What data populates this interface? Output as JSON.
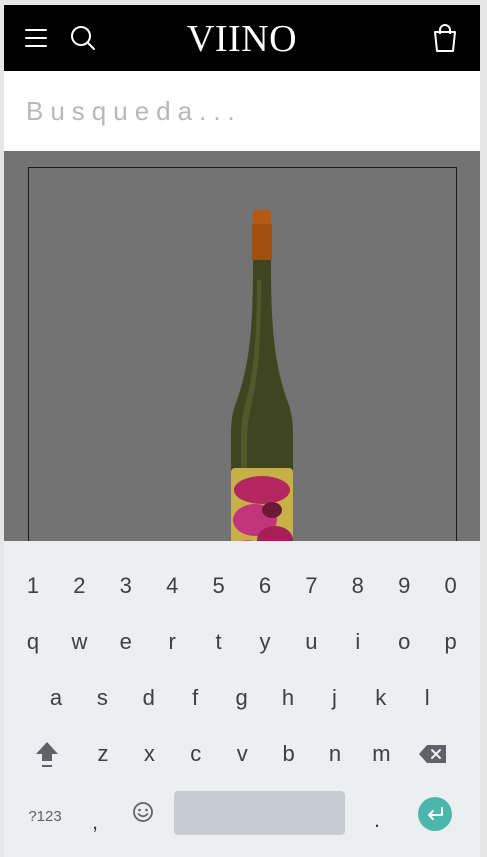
{
  "header": {
    "brand": "VIINO",
    "icons": {
      "menu": "menu-icon",
      "search": "search-icon",
      "cart": "shopping-bag-icon"
    }
  },
  "search": {
    "placeholder": "Busqueda...",
    "value": ""
  },
  "colors": {
    "topbar": "#000000",
    "overlay": "#737373",
    "keyboard": "#eceff1",
    "enter": "#4db6ac"
  },
  "keyboard": {
    "numbers": [
      "1",
      "2",
      "3",
      "4",
      "5",
      "6",
      "7",
      "8",
      "9",
      "0"
    ],
    "row1": [
      "q",
      "w",
      "e",
      "r",
      "t",
      "y",
      "u",
      "i",
      "o",
      "p"
    ],
    "row2": [
      "a",
      "s",
      "d",
      "f",
      "g",
      "h",
      "j",
      "k",
      "l"
    ],
    "row3": [
      "z",
      "x",
      "c",
      "v",
      "b",
      "n",
      "m"
    ],
    "symbols_label": "?123",
    "comma": ",",
    "period": ".",
    "icons": {
      "shift": "shift-icon",
      "backspace": "backspace-icon",
      "emoji": "emoji-icon",
      "enter": "enter-icon"
    }
  }
}
